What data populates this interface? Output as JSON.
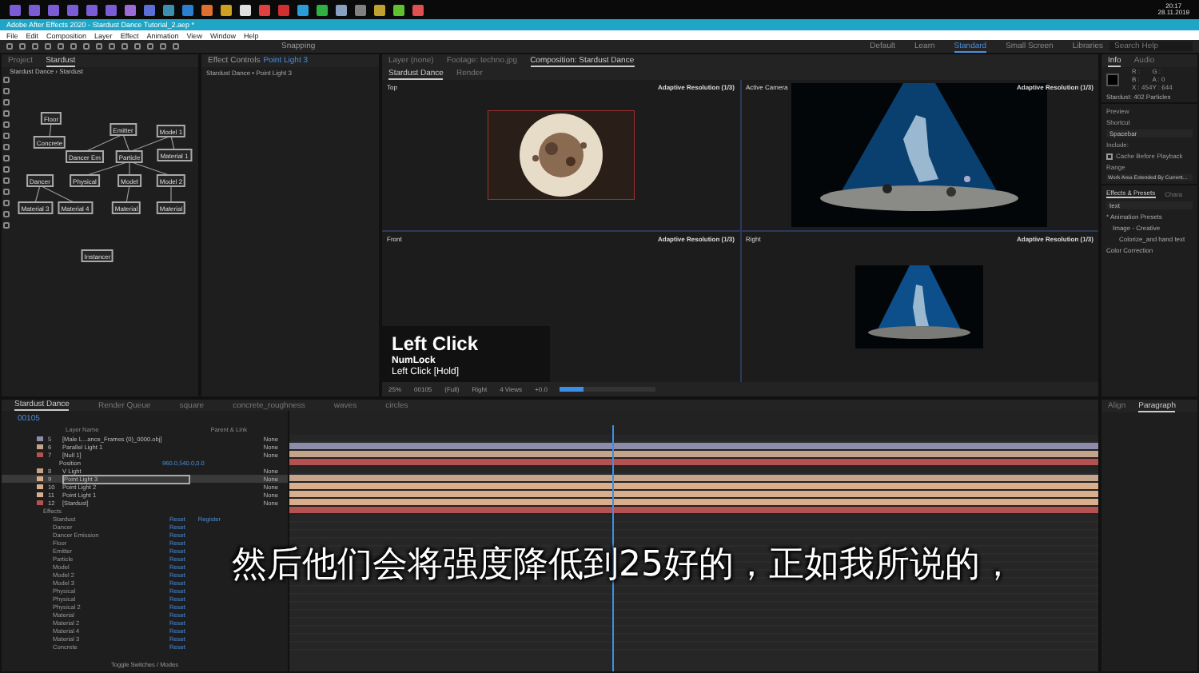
{
  "taskbar": {
    "apps": [
      {
        "color": "#7a5cd6"
      },
      {
        "color": "#7a5cd6"
      },
      {
        "color": "#7a5cd6"
      },
      {
        "color": "#7a5cd6"
      },
      {
        "color": "#7a5cd6"
      },
      {
        "color": "#7a5cd6"
      },
      {
        "color": "#9b6bd8"
      },
      {
        "color": "#5b6fd8"
      },
      {
        "color": "#3d8fb0"
      },
      {
        "color": "#2b7fd0"
      },
      {
        "color": "#e07030"
      },
      {
        "color": "#d0a020"
      },
      {
        "color": "#e0e0e0"
      },
      {
        "color": "#e04040"
      },
      {
        "color": "#d03030"
      },
      {
        "color": "#2a9dd8"
      },
      {
        "color": "#30b040"
      },
      {
        "color": "#8aa0c0"
      },
      {
        "color": "#808080"
      },
      {
        "color": "#c0a030"
      },
      {
        "color": "#60c030"
      },
      {
        "color": "#e05050"
      }
    ],
    "clock": {
      "time": "20:17",
      "date": "28.11.2019"
    }
  },
  "window": {
    "title": "Adobe After Effects 2020 - Stardust Dance Tutorial_2.aep *"
  },
  "menu": [
    "File",
    "Edit",
    "Composition",
    "Layer",
    "Effect",
    "Animation",
    "View",
    "Window",
    "Help"
  ],
  "toolbar": {
    "snapping": "Snapping",
    "workspaces": [
      {
        "label": "Default",
        "selected": false
      },
      {
        "label": "Learn",
        "selected": false
      },
      {
        "label": "Standard",
        "selected": true
      },
      {
        "label": "Small Screen",
        "selected": false
      },
      {
        "label": "Libraries",
        "selected": false
      }
    ],
    "search": {
      "placeholder": "Search Help"
    }
  },
  "left_panel": {
    "tabs": [
      {
        "label": "Project",
        "selected": false
      },
      {
        "label": "Stardust",
        "selected": true
      }
    ],
    "breadcrumb": "Stardust Dance › Stardust",
    "nodes": [
      {
        "label": "Floor"
      },
      {
        "label": "Emitter"
      },
      {
        "label": "Model 1"
      },
      {
        "label": "Concrete"
      },
      {
        "label": "Dancer Em"
      },
      {
        "label": "Particle"
      },
      {
        "label": "Material 1"
      },
      {
        "label": "Dancer"
      },
      {
        "label": "Physical"
      },
      {
        "label": "Model"
      },
      {
        "label": "Model 2"
      },
      {
        "label": "Material 3"
      },
      {
        "label": "Material 4"
      },
      {
        "label": "Material"
      },
      {
        "label": "Material"
      },
      {
        "label": "Instancer"
      }
    ]
  },
  "effect_controls": {
    "tab": "Effect Controls",
    "layer": "Point Light 3",
    "subtitle": "Stardust Dance • Point Light 3"
  },
  "viewer": {
    "tabs": [
      {
        "label": "Layer (none)",
        "selected": false
      },
      {
        "label": "Footage: techno.jpg",
        "selected": false
      },
      {
        "label": "Composition: Stardust Dance",
        "selected": true
      }
    ],
    "subtabs": [
      {
        "label": "Stardust Dance",
        "selected": true
      },
      {
        "label": "Render",
        "selected": false
      }
    ],
    "views": [
      {
        "name": "Top",
        "resolution": "Adaptive Resolution (1/3)"
      },
      {
        "name": "Active Camera",
        "resolution": "Adaptive Resolution (1/3)"
      },
      {
        "name": "Front",
        "resolution": "Adaptive Resolution (1/3)"
      },
      {
        "name": "Right",
        "resolution": "Adaptive Resolution (1/3)"
      }
    ],
    "key_overlay": {
      "title": "Left Click",
      "line1": "NumLock",
      "line2": "Left Click [Hold]"
    },
    "footer": {
      "zoom": "25%",
      "time": "00105",
      "quality": "(Full)",
      "view": "Right",
      "layout": "4 Views",
      "exposure": "+0.0",
      "level": 0.25
    }
  },
  "right_panel": {
    "info_tabs": [
      {
        "label": "Info",
        "selected": true
      },
      {
        "label": "Audio",
        "selected": false
      }
    ],
    "info_values": [
      "R :",
      "G :",
      "B :",
      "A : 0",
      "X : 454",
      "Y : 644"
    ],
    "info_note": "Stardust: 402 Particles",
    "preview": {
      "title": "Preview",
      "shortcut_label": "Shortcut",
      "shortcut": "Spacebar",
      "include_label": "Include:",
      "cache_label": "Cache Before Playback",
      "cache_checked": false,
      "range_label": "Range",
      "range": "Work Area Extended By Current..."
    },
    "effects_tabs": [
      {
        "label": "Effects & Presets",
        "selected": true
      },
      {
        "label": "Chara",
        "selected": false
      }
    ],
    "effects_search": "text",
    "tree": [
      {
        "label": "* Animation Presets",
        "children": [
          {
            "label": "Image - Creative",
            "children": [
              {
                "label": "Colorize_and hand text"
              }
            ]
          }
        ]
      },
      {
        "label": "Color Correction"
      }
    ]
  },
  "timeline": {
    "tabs": [
      {
        "label": "Stardust Dance",
        "selected": true
      },
      {
        "label": "Render Queue",
        "selected": false
      },
      {
        "label": "square",
        "selected": false
      },
      {
        "label": "concrete_roughness",
        "selected": false
      },
      {
        "label": "waves",
        "selected": false
      },
      {
        "label": "circles",
        "selected": false
      }
    ],
    "time": "00105",
    "header": {
      "source": "Layer Name",
      "parent": "Parent & Link"
    },
    "layers": [
      {
        "kind": "layer",
        "number": "5",
        "name": "[Male L...ance_Frames (0)_0000.obj]",
        "color": "#8e8cab",
        "selected": false,
        "parent": "None"
      },
      {
        "kind": "layer",
        "number": "6",
        "name": "Parallel Light 1",
        "color": "#c4a48a",
        "selected": false,
        "parent": "None"
      },
      {
        "kind": "layer",
        "number": "7",
        "name": "[Null 1]",
        "color": "#b45252",
        "selected": false,
        "parent": "None"
      },
      {
        "kind": "property",
        "name": "Position",
        "value": "960.0,540.0,0.0"
      },
      {
        "kind": "layer",
        "number": "8",
        "name": "V Light",
        "color": "#c4a48a",
        "selected": false,
        "parent": "None"
      },
      {
        "kind": "layer",
        "number": "9",
        "name": "Point Light 3",
        "color": "#d8ae8c",
        "selected": true,
        "parent": "None"
      },
      {
        "kind": "layer",
        "number": "10",
        "name": "Point Light 2",
        "color": "#d8ae8c",
        "selected": false,
        "parent": "None"
      },
      {
        "kind": "layer",
        "number": "11",
        "name": "Point Light 1",
        "color": "#d8ae8c",
        "selected": false,
        "parent": "None"
      },
      {
        "kind": "layer",
        "number": "12",
        "name": "[Stardust]",
        "color": "#b45252",
        "selected": false,
        "parent": "None"
      }
    ],
    "effects_label": "Effects",
    "effects": [
      {
        "name": "Stardust",
        "reset": "Reset",
        "register": "Register"
      },
      {
        "name": "Dancer",
        "reset": "Reset"
      },
      {
        "name": "Dancer Emission",
        "reset": "Reset"
      },
      {
        "name": "Floor",
        "reset": "Reset"
      },
      {
        "name": "Emitter",
        "reset": "Reset"
      },
      {
        "name": "Particle",
        "reset": "Reset"
      },
      {
        "name": "Model",
        "reset": "Reset"
      },
      {
        "name": "Model 2",
        "reset": "Reset"
      },
      {
        "name": "Model 3",
        "reset": "Reset"
      },
      {
        "name": "Physical",
        "reset": "Reset"
      },
      {
        "name": "Physical",
        "reset": "Reset"
      },
      {
        "name": "Physical 2",
        "reset": "Reset"
      },
      {
        "name": "Material",
        "reset": "Reset"
      },
      {
        "name": "Material 2",
        "reset": "Reset"
      },
      {
        "name": "Material 4",
        "reset": "Reset"
      },
      {
        "name": "Material 3",
        "reset": "Reset"
      },
      {
        "name": "Concrete",
        "reset": "Reset"
      }
    ],
    "footer": "Toggle Switches / Modes"
  },
  "paragraph_panel": {
    "tabs": [
      {
        "label": "Align",
        "selected": false
      },
      {
        "label": "Paragraph",
        "selected": true
      }
    ]
  },
  "subtitle": "然后他们会将强度降低到25好的，正如我所说的，"
}
